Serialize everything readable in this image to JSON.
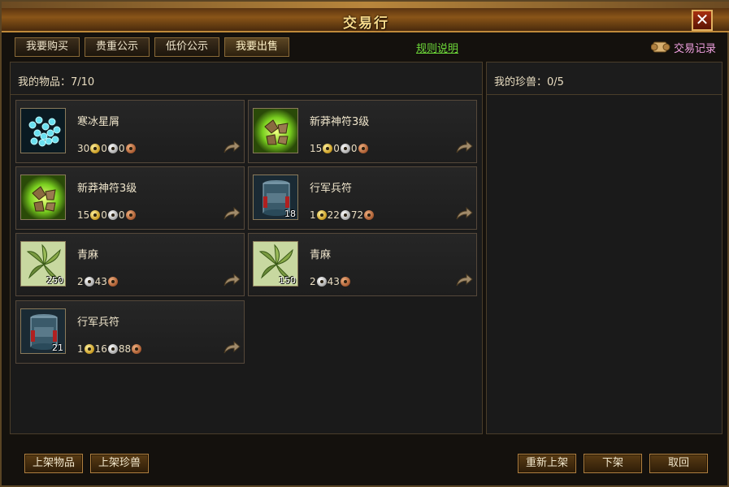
{
  "window": {
    "title": "交易行",
    "close_label": "✕"
  },
  "tabs": [
    {
      "label": "我要购买"
    },
    {
      "label": "贵重公示"
    },
    {
      "label": "低价公示"
    },
    {
      "label": "我要出售"
    }
  ],
  "rules_link": "规则说明",
  "trade_record": "交易记录",
  "left_panel": {
    "title": "我的物品：7/10"
  },
  "right_panel": {
    "title": "我的珍兽：0/5"
  },
  "items": [
    {
      "name": "寒冰星屑",
      "icon": "ice-crystal-icon",
      "qty": "",
      "price": [
        "30",
        "0",
        "0"
      ],
      "coins": [
        "gold",
        "silver",
        "copper"
      ]
    },
    {
      "name": "新莽神符3级",
      "icon": "rune-icon",
      "qty": "",
      "price": [
        "15",
        "0",
        "0"
      ],
      "coins": [
        "gold",
        "silver",
        "copper"
      ]
    },
    {
      "name": "新莽神符3级",
      "icon": "rune-icon",
      "qty": "",
      "price": [
        "15",
        "0",
        "0"
      ],
      "coins": [
        "gold",
        "silver",
        "copper"
      ]
    },
    {
      "name": "行军兵符",
      "icon": "army-token-icon",
      "qty": "18",
      "price": [
        "1",
        "22",
        "72"
      ],
      "coins": [
        "gold",
        "silver",
        "copper"
      ]
    },
    {
      "name": "青麻",
      "icon": "herb-leaf-icon",
      "qty": "250",
      "price": [
        "2",
        "43"
      ],
      "coins": [
        "silver",
        "copper"
      ]
    },
    {
      "name": "青麻",
      "icon": "herb-leaf-icon",
      "qty": "150",
      "price": [
        "2",
        "43"
      ],
      "coins": [
        "silver",
        "copper"
      ]
    },
    {
      "name": "行军兵符",
      "icon": "army-token-icon",
      "qty": "21",
      "price": [
        "1",
        "16",
        "88"
      ],
      "coins": [
        "gold",
        "silver",
        "copper"
      ]
    }
  ],
  "buttons": {
    "list_item": "上架物品",
    "list_pet": "上架珍兽",
    "relist": "重新上架",
    "delist": "下架",
    "cancel": "取回"
  }
}
